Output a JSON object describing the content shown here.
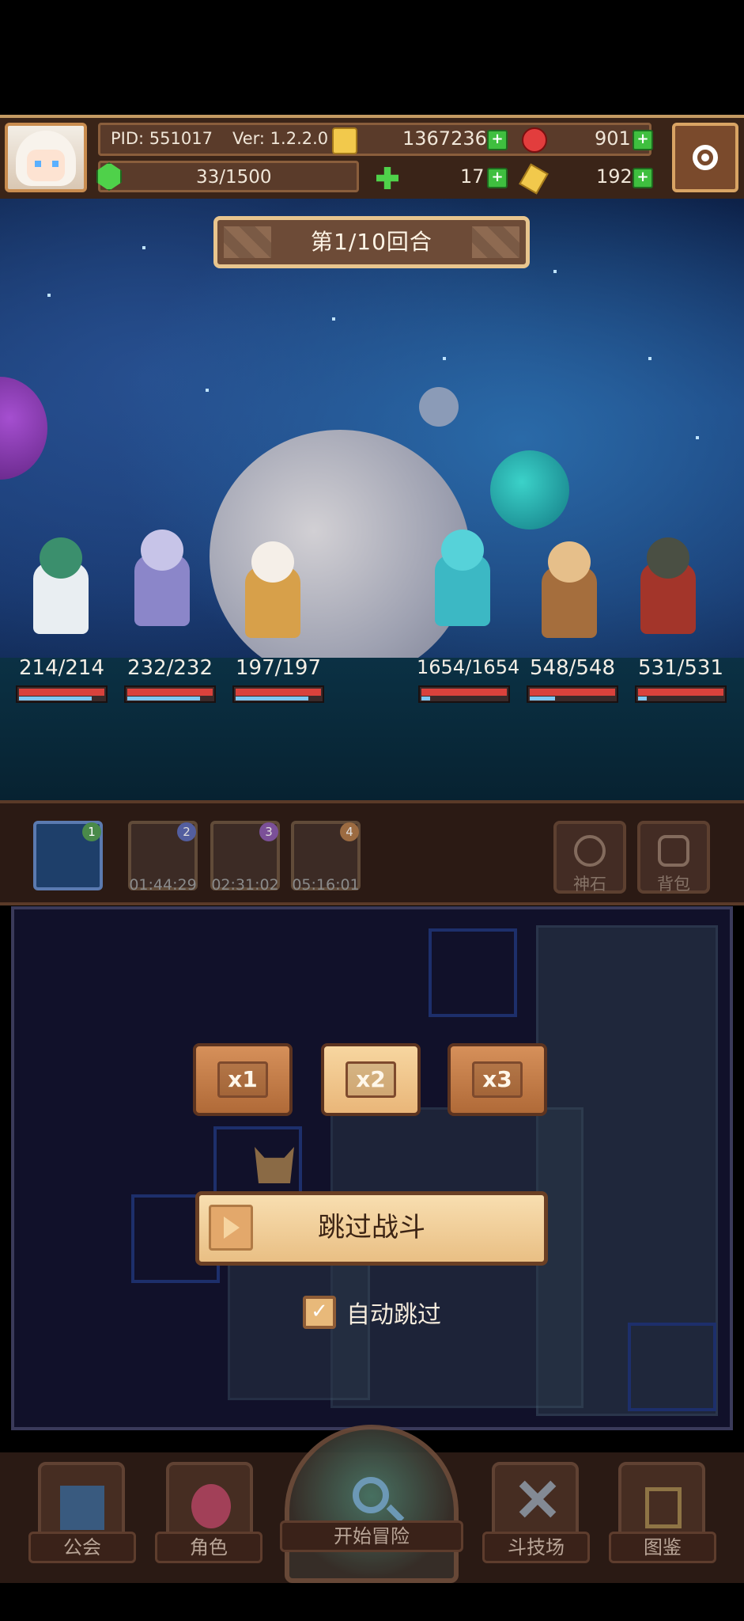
{
  "header": {
    "pid": "PID: 551017",
    "version": "Ver: 1.2.2.0",
    "gold": "1367236",
    "gems": "901",
    "energy": "33/1500",
    "clover": "17",
    "keys": "192"
  },
  "battle": {
    "round_label": "第1/10回合",
    "allies": [
      {
        "hp": "214/214",
        "hp_fraction": 1.0,
        "mana_fraction": 0.85
      },
      {
        "hp": "232/232",
        "hp_fraction": 1.0,
        "mana_fraction": 0.85
      },
      {
        "hp": "197/197",
        "hp_fraction": 1.0,
        "mana_fraction": 0.85
      }
    ],
    "enemies": [
      {
        "hp": "1654/1654",
        "hp_fraction": 1.0,
        "mana_fraction": 0.1
      },
      {
        "hp": "548/548",
        "hp_fraction": 1.0,
        "mana_fraction": 0.3
      },
      {
        "hp": "531/531",
        "hp_fraction": 1.0,
        "mana_fraction": 0.1
      }
    ]
  },
  "slots": [
    {
      "number": "1",
      "timer": ""
    },
    {
      "number": "2",
      "timer": "01:44:29"
    },
    {
      "number": "3",
      "timer": "02:31:02"
    },
    {
      "number": "4",
      "timer": "05:16:01"
    }
  ],
  "side_buttons": {
    "god_stone": "神石",
    "backpack": "背包"
  },
  "speed": {
    "x1": "x1",
    "x2": "x2",
    "x3": "x3"
  },
  "skip_button": "跳过战斗",
  "auto_skip": {
    "label": "自动跳过",
    "checked": true,
    "check_mark": "✓"
  },
  "nav": {
    "guild": "公会",
    "characters": "角色",
    "adventure": "开始冒险",
    "arena": "斗技场",
    "codex": "图鉴"
  },
  "colors": {
    "accent": "#e9bf84",
    "hp_red": "#d9423c",
    "mana_blue": "#7ec8f2",
    "plus_green": "#3fbf3f"
  }
}
